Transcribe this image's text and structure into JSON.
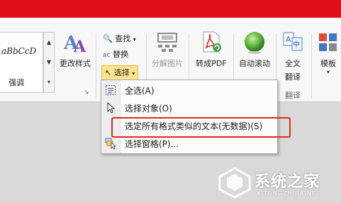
{
  "ribbon": {
    "style_gallery": {
      "sample": "aBbCcD",
      "name": "强调"
    },
    "change_styles": "更改样式",
    "find": "查找",
    "replace": "替换",
    "select": "选择",
    "split_image": "分解图片",
    "to_pdf": "转成PDF",
    "auto_scroll": "自动滚动",
    "full_translate": {
      "line1": "全文",
      "line2": "翻译"
    },
    "translate_group": "翻译",
    "template": "模板"
  },
  "select_menu": {
    "items": [
      {
        "label": "全选(A)",
        "icon": "select-all-icon"
      },
      {
        "label": "选择对象(O)",
        "icon": "pointer-icon"
      },
      {
        "label": "选定所有格式类似的文本(无数据)(S)",
        "icon": ""
      },
      {
        "label": "选择窗格(P)...",
        "icon": "selection-pane-icon"
      }
    ]
  },
  "watermark": {
    "title": "系统之家",
    "url": "XITONGZHIJIA.NET"
  },
  "colors": {
    "titlebar": "#e0101a",
    "highlight": "#fde58f",
    "callout": "#e2261f"
  }
}
